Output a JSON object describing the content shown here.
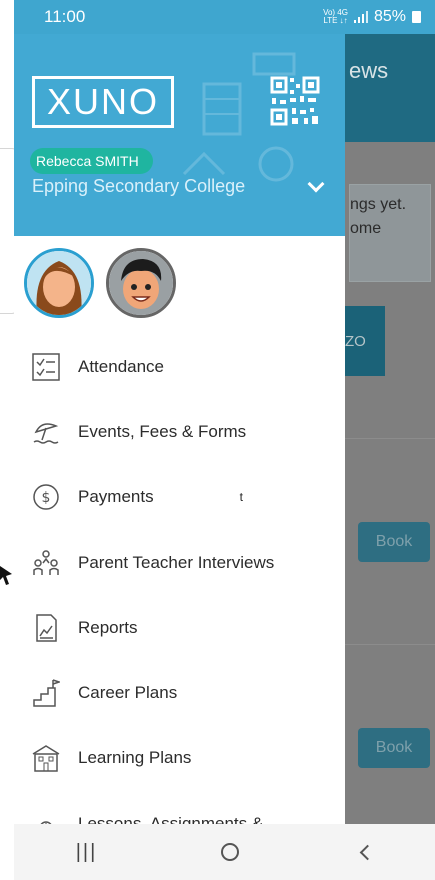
{
  "status_bar": {
    "time": "11:00",
    "net_top": "Vo) 4G",
    "net_bottom": "LTE ↓↑",
    "battery": "85%"
  },
  "background": {
    "header_fragment": "ews",
    "card_line1": "ngs yet.",
    "card_line2": "ome",
    "button_fragment": "ZO",
    "book_label_1": "Book",
    "book_label_2": "Book"
  },
  "drawer": {
    "logo": "XUNO",
    "user_name": "Rebecca SMITH",
    "school": "Epping Secondary College",
    "menu": [
      {
        "label": "Attendance",
        "icon": "attendance-checklist-icon"
      },
      {
        "label": "Events, Fees & Forms",
        "icon": "events-umbrella-icon"
      },
      {
        "label": "Payments",
        "icon": "dollar-coin-icon"
      },
      {
        "label": "Parent Teacher Interviews",
        "icon": "people-group-icon"
      },
      {
        "label": "Reports",
        "icon": "report-chart-icon"
      },
      {
        "label": "Career Plans",
        "icon": "steps-flag-icon"
      },
      {
        "label": "Learning Plans",
        "icon": "school-building-icon"
      },
      {
        "label": "Lessons, Assignments &",
        "icon": "lesson-icon"
      }
    ]
  },
  "overlay_text": "t",
  "nav_bar": {
    "recent": "|||"
  },
  "colors": {
    "header_blue": "#42a9d3",
    "status_blue": "#3fa6cf",
    "highlight_teal": "#1fb5a0",
    "dim_overlay": "#7f7f7f"
  }
}
